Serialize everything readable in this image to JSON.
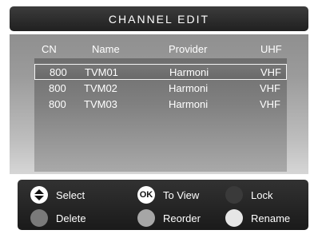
{
  "title": "CHANNEL  EDIT",
  "columns": {
    "cn": "CN",
    "name": "Name",
    "provider": "Provider",
    "band": "UHF"
  },
  "channels": [
    {
      "cn": "800",
      "name": "TVM01",
      "provider": "Harmoni",
      "band": "VHF",
      "selected": true
    },
    {
      "cn": "800",
      "name": "TVM02",
      "provider": "Harmoni",
      "band": "VHF",
      "selected": false
    },
    {
      "cn": "800",
      "name": "TVM03",
      "provider": "Harmoni",
      "band": "VHF",
      "selected": false
    }
  ],
  "help": {
    "select": {
      "label": "Select",
      "icon": "up-down-arrow-icon",
      "color": "#ffffff"
    },
    "to_view": {
      "label": "To View",
      "icon": "ok-icon",
      "icon_text": "OK",
      "color": "#ffffff"
    },
    "lock": {
      "label": "Lock",
      "icon": "dark-gray-button-icon",
      "color": "#3a3a3a"
    },
    "delete": {
      "label": "Delete",
      "icon": "gray-button-icon",
      "color": "#7a7a7a"
    },
    "reorder": {
      "label": "Reorder",
      "icon": "light-gray-button-icon",
      "color": "#a6a6a6"
    },
    "rename": {
      "label": "Rename",
      "icon": "white-button-icon",
      "color": "#e6e6e6"
    }
  }
}
